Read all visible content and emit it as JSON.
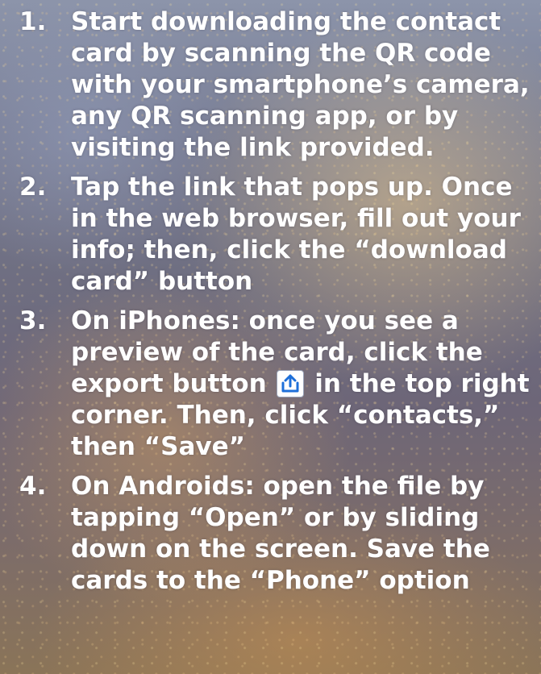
{
  "steps": [
    {
      "number": "1.",
      "text": "Start downloading the contact card by scanning the QR code with your smartphone’s camera, any QR scanning app, or by visiting the link provided."
    },
    {
      "number": "2.",
      "text": "Tap the link that pops up. Once in the web browser, fill out your info; then, click the “download card” button"
    },
    {
      "number": "3.",
      "text_before": "On iPhones: once you see a preview of the card, click the export button",
      "text_after": "in the top right corner. Then, click “contacts,” then “Save”",
      "icon": "share-export-icon"
    },
    {
      "number": "4.",
      "text": "On Androids: open the file by tapping “Open” or by sliding down on the screen. Save the cards to the “Phone” option"
    }
  ],
  "colors": {
    "text": "#ffffff",
    "icon_blue": "#1e6fd9"
  }
}
